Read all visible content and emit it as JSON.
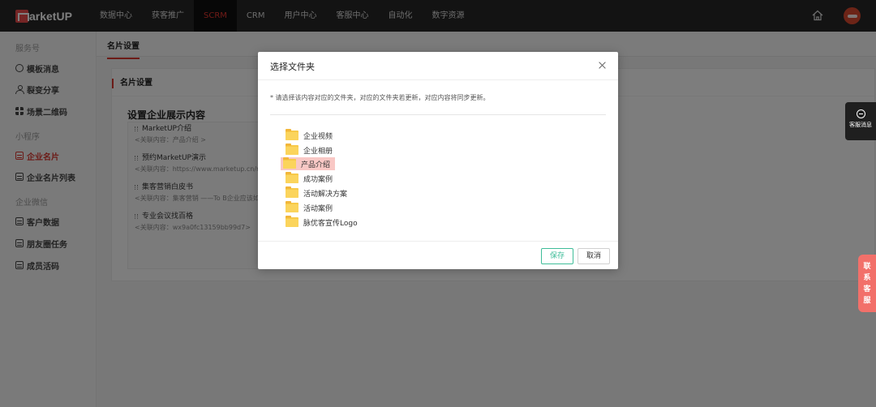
{
  "brand": {
    "logo_text": "arketUP"
  },
  "nav": {
    "items": [
      {
        "label": "数据中心"
      },
      {
        "label": "获客推广"
      },
      {
        "label": "SCRM",
        "active": true
      },
      {
        "label": "CRM"
      },
      {
        "label": "用户中心"
      },
      {
        "label": "客服中心"
      },
      {
        "label": "自动化"
      },
      {
        "label": "数字资源"
      }
    ],
    "home_icon": "home-icon",
    "accent_color": "#e2362f"
  },
  "sidebar": {
    "groups": [
      {
        "label": "服务号",
        "items": [
          {
            "label": "模板消息",
            "icon": "template-icon"
          },
          {
            "label": "裂变分享",
            "icon": "share-icon"
          },
          {
            "label": "场景二维码",
            "icon": "qrcode-icon"
          }
        ]
      },
      {
        "label": "小程序",
        "items": [
          {
            "label": "企业名片",
            "icon": "card-icon",
            "active": true
          },
          {
            "label": "企业名片列表",
            "icon": "list-icon"
          }
        ]
      },
      {
        "label": "企业微信",
        "items": [
          {
            "label": "客户数据",
            "icon": "customer-icon"
          },
          {
            "label": "朋友圈任务",
            "icon": "moments-icon"
          },
          {
            "label": "成员活码",
            "icon": "member-code-icon"
          }
        ]
      }
    ]
  },
  "content": {
    "tab": "名片设置",
    "card_title": "名片设置",
    "section_title": "设置企业展示内容",
    "items": [
      {
        "title": "MarketUP介绍",
        "sub": "<关联内容：产品介绍 >"
      },
      {
        "title": "预约MarketUP演示",
        "sub": "<关联内容：https://www.marketup.cn/r"
      },
      {
        "title": "集客营销白皮书",
        "sub": "<关联内容：集客营销 ——To B企业应该如"
      },
      {
        "title": "专业会议找百格",
        "sub": "<关联内容：wx9a0fc13159bb99d7>"
      }
    ]
  },
  "floating": {
    "message_label": "客服消息",
    "contact_label": [
      "联",
      "系",
      "客",
      "服"
    ]
  },
  "dialog": {
    "title": "选择文件夹",
    "note": "* 请选择该内容对应的文件夹，对应的文件夹若更新，对应内容将同步更新。",
    "folders": [
      {
        "label": "企业视频"
      },
      {
        "label": "企业相册"
      },
      {
        "label": "产品介绍",
        "selected": true
      },
      {
        "label": "成功案例"
      },
      {
        "label": "活动解决方案"
      },
      {
        "label": "活动案例"
      },
      {
        "label": "脉优客宣传Logo"
      }
    ],
    "save_label": "保存",
    "cancel_label": "取消",
    "save_color": "#3fbd99",
    "selected_color": "#f9c8c5"
  }
}
